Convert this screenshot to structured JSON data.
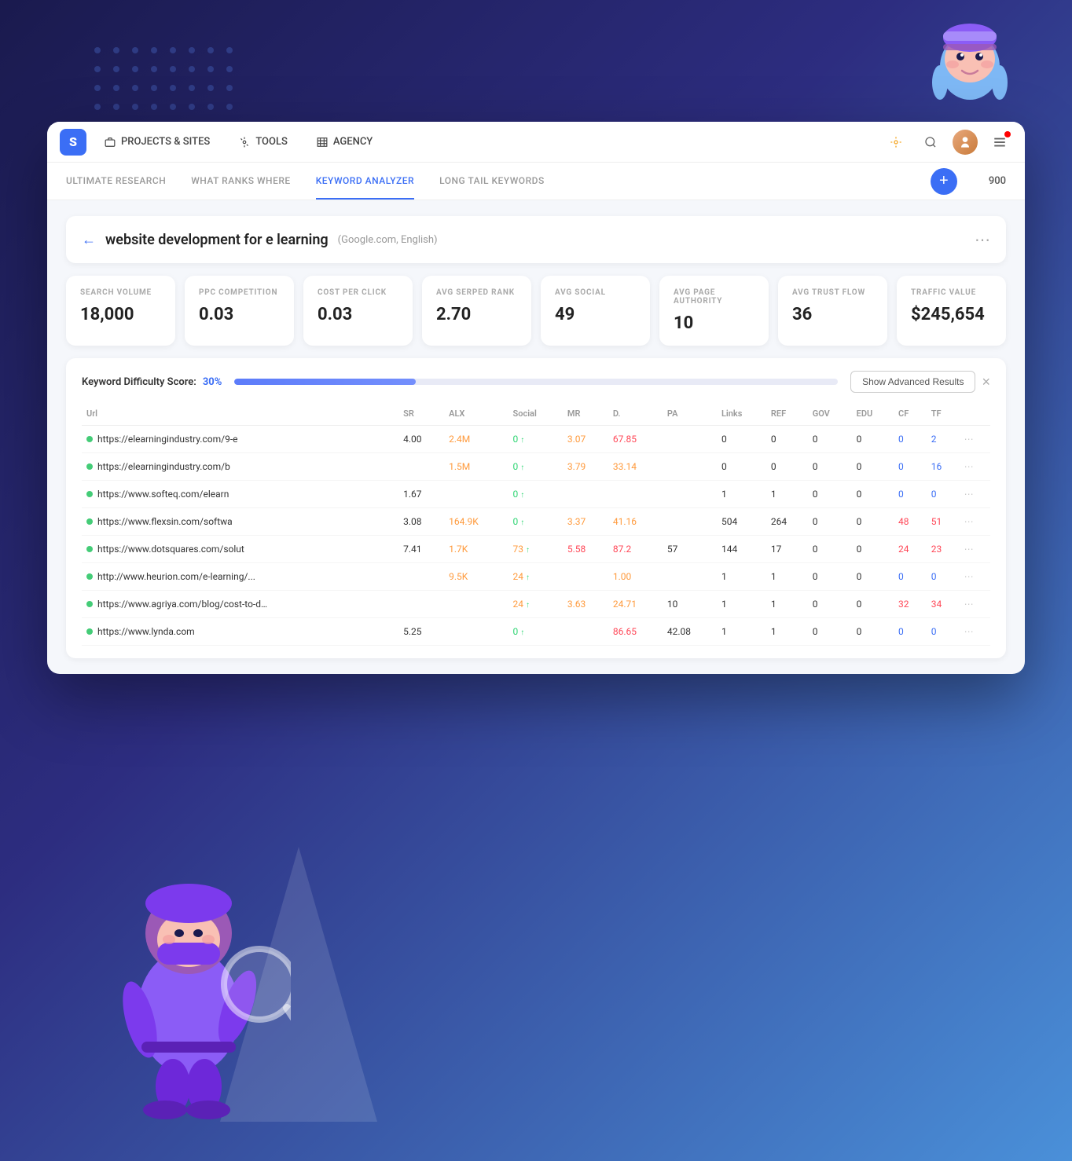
{
  "app": {
    "logo": "S",
    "nav": {
      "items": [
        {
          "label": "PROJECTS & SITES",
          "icon": "briefcase"
        },
        {
          "label": "TOOLS",
          "icon": "wrench"
        },
        {
          "label": "AGENCY",
          "icon": "building"
        }
      ]
    },
    "credits": "900"
  },
  "sub_nav": {
    "tabs": [
      {
        "label": "ULTIMATE RESEARCH",
        "active": false
      },
      {
        "label": "WHAT RANKS WHERE",
        "active": false
      },
      {
        "label": "KEYWORD ANALYZER",
        "active": true
      },
      {
        "label": "LONG TAIL KEYWORDS",
        "active": false
      }
    ]
  },
  "keyword_header": {
    "back_label": "←",
    "keyword": "website development for e learning",
    "meta": "(Google.com, English)"
  },
  "stats": [
    {
      "label": "SEARCH VOLUME",
      "value": "18,000"
    },
    {
      "label": "PPC COMPETITION",
      "value": "0.03"
    },
    {
      "label": "COST PER CLICK",
      "value": "0.03"
    },
    {
      "label": "AVG SERPED RANK",
      "value": "2.70"
    },
    {
      "label": "AVG SOCIAL",
      "value": "49"
    },
    {
      "label": "AVG PAGE AUTHORITY",
      "value": "10"
    },
    {
      "label": "AVG TRUST FLOW",
      "value": "36"
    },
    {
      "label": "TRAFFIC VALUE",
      "value": "$245,654"
    }
  ],
  "difficulty": {
    "label": "Keyword Difficulty Score:",
    "score": "30%",
    "progress": 30,
    "show_advanced_label": "Show Advanced Results"
  },
  "table": {
    "columns": [
      "Url",
      "SR",
      "ALX",
      "Social",
      "MR",
      "D.",
      "PA",
      "Links",
      "REF",
      "GOV",
      "EDU",
      "CF",
      "TF"
    ],
    "rows": [
      {
        "url": "https://elearningindustry.com/9-e",
        "sr": "4.00",
        "alx": "2.4M",
        "social": "0",
        "social_trend": "↑",
        "mr": "3.07",
        "d": "67.85",
        "pa": "",
        "links": "0",
        "ref": "0",
        "gov": "0",
        "edu": "0",
        "cf": "0",
        "tf": "2",
        "alx_color": "orange",
        "mr_color": "orange",
        "d_color": "red",
        "social_color": "green"
      },
      {
        "url": "https://elearningindustry.com/b",
        "sr": "",
        "alx": "1.5M",
        "social": "0",
        "social_trend": "↑",
        "mr": "3.79",
        "d": "33.14",
        "pa": "",
        "links": "0",
        "ref": "0",
        "gov": "0",
        "edu": "0",
        "cf": "0",
        "tf": "16",
        "alx_color": "orange",
        "mr_color": "orange",
        "d_color": "orange",
        "social_color": "green"
      },
      {
        "url": "https://www.softeq.com/elearn",
        "sr": "1.67",
        "alx": "",
        "social": "0",
        "social_trend": "↑",
        "mr": "",
        "d": "",
        "pa": "",
        "links": "1",
        "ref": "1",
        "gov": "0",
        "edu": "0",
        "cf": "0",
        "tf": "0",
        "alx_color": "",
        "mr_color": "",
        "d_color": "",
        "social_color": "green"
      },
      {
        "url": "https://www.flexsin.com/softwa",
        "sr": "3.08",
        "alx": "164.9K",
        "social": "0",
        "social_trend": "↑",
        "mr": "3.37",
        "d": "41.16",
        "pa": "",
        "links": "504",
        "ref": "264",
        "gov": "0",
        "edu": "0",
        "cf": "48",
        "tf": "51",
        "alx_color": "orange",
        "mr_color": "orange",
        "d_color": "orange",
        "social_color": "green",
        "cf_color": "red",
        "tf_color": "red"
      },
      {
        "url": "https://www.dotsquares.com/solut",
        "sr": "7.41",
        "alx": "1.7K",
        "social": "73",
        "social_trend": "↑",
        "mr": "5.58",
        "d": "87.2",
        "pa": "57",
        "links": "144",
        "ref": "17",
        "gov": "0",
        "edu": "0",
        "cf": "24",
        "tf": "23",
        "alx_color": "orange",
        "mr_color": "red",
        "d_color": "red",
        "social_color": "orange",
        "cf_color": "red",
        "tf_color": "red"
      },
      {
        "url": "http://www.heurion.com/e-learning/...",
        "sr": "",
        "alx": "9.5K",
        "social": "24",
        "social_trend": "↑",
        "mr": "",
        "d": "1.00",
        "pa": "",
        "links": "1",
        "ref": "1",
        "gov": "0",
        "edu": "0",
        "cf": "0",
        "tf": "0",
        "alx_color": "orange",
        "mr_color": "",
        "d_color": "orange",
        "social_color": "orange"
      },
      {
        "url": "https://www.agriya.com/blog/cost-to-deve...",
        "sr": "",
        "alx": "",
        "social": "24",
        "social_trend": "↑",
        "mr": "3.63",
        "d": "24.71",
        "pa": "10",
        "links": "1",
        "ref": "1",
        "gov": "0",
        "edu": "0",
        "cf": "32",
        "tf": "34",
        "alx_color": "",
        "mr_color": "orange",
        "d_color": "orange",
        "social_color": "orange",
        "cf_color": "red",
        "tf_color": "red"
      },
      {
        "url": "https://www.lynda.com",
        "sr": "5.25",
        "alx": "",
        "social": "0",
        "social_trend": "↑",
        "mr": "",
        "d": "86.65",
        "pa": "42.08",
        "links": "1",
        "ref": "1",
        "gov": "0",
        "edu": "0",
        "cf": "0",
        "tf": "0",
        "alx_color": "",
        "mr_color": "",
        "d_color": "red",
        "social_color": "green"
      }
    ]
  },
  "add_button_label": "+",
  "close_label": "×"
}
